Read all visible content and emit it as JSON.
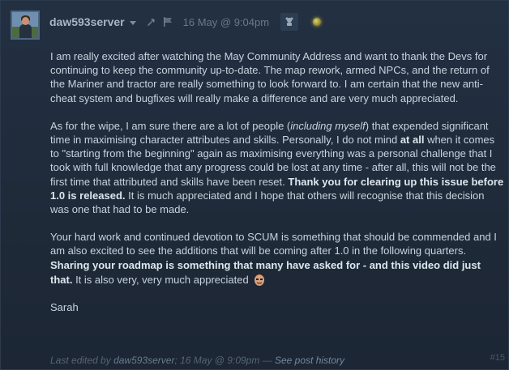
{
  "author": {
    "name": "daw593server",
    "timestamp": "16 May @ 9:04pm"
  },
  "body": {
    "p1": "I am really excited after watching the May Community Address and want to thank the Devs for continuing to keep the community up-to-date. The map rework, armed NPCs, and the return of the Mariner and tractor are really something to look forward to. I am certain that the new anti-cheat system and bugfixes will really make a difference and are very much appreciated.",
    "p2_a": "As for the wipe, I am sure there are a lot of people (",
    "p2_b": "including myself",
    "p2_c": ") that expended significant time in maximising character attributes and skills. Personally, I do not mind ",
    "p2_d": "at all",
    "p2_e": " when it comes to \"starting from the beginning\" again as maximising everything was a personal challenge that I took with full knowledge that any progress could be lost at any time - after all, this will not be the first time that attributed and skills have been reset. ",
    "p2_f": "Thank you for clearing up this issue before 1.0 is released.",
    "p2_g": " It is much appreciated and I hope that others will recognise that this decision was one that had to be made.",
    "p3_a": "Your hard work and continued devotion to SCUM is something that should be commended and I am also excited to see the additions that will be coming after 1.0 in the following quarters. ",
    "p3_b": "Sharing your roadmap is something that many have asked for - and this video did just that.",
    "p3_c": " It is also very, very much appreciated",
    "signoff": "Sarah"
  },
  "footer": {
    "prefix": "Last edited by ",
    "editor": "daw593server",
    "edit_time": "; 16 May @ 9:09pm — ",
    "history_link": "See post history",
    "post_number": "#15"
  },
  "icons": {
    "dropdown": "chevron-down-icon",
    "pin": "pin-icon",
    "flag": "flag-icon",
    "award": "award-icon",
    "badge": "badge-orb-icon",
    "emote": "smiley-emote-icon"
  },
  "colors": {
    "background": "#1f2a39",
    "text": "#c6d4df",
    "author": "#a7b6c6",
    "muted": "#6a7989"
  }
}
